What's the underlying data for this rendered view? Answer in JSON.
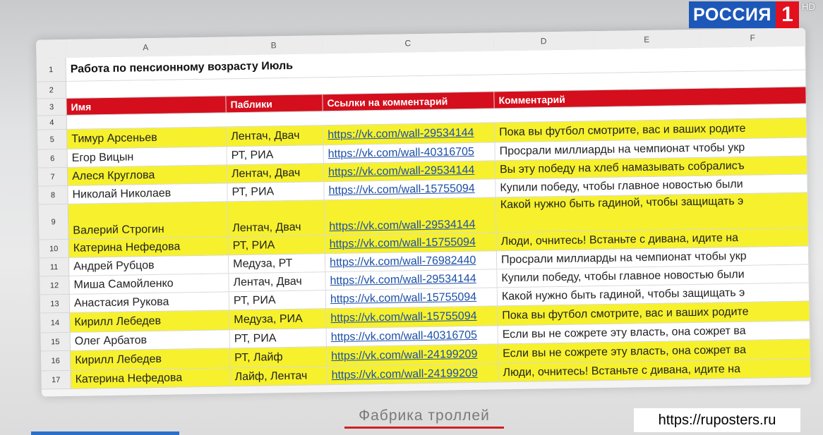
{
  "overlay": {
    "channel_logo": "РОССИЯ",
    "channel_number": "1",
    "hd_badge": "HD",
    "caption": "Фабрика троллей",
    "watermark": "https://ruposters.ru"
  },
  "spreadsheet": {
    "columns": [
      "A",
      "B",
      "C",
      "D",
      "E",
      "F"
    ],
    "title": "Работа по пенсионному возрасту Июль",
    "headers": [
      "Имя",
      "Паблики",
      "Ссылки на комментарий",
      "Комментарий"
    ],
    "row_numbers": [
      "1",
      "2",
      "3",
      "4",
      "5",
      "6",
      "7",
      "8",
      "9",
      "10",
      "11",
      "12",
      "13",
      "14",
      "15",
      "16",
      "17"
    ],
    "rows": [
      {
        "name": "Тимур Арсеньев",
        "publics": "Лентач, Двач",
        "link": "https://vk.com/wall-29534144",
        "comment": "Пока вы футбол смотрите, вас и ваших родите",
        "highlight": "yellow"
      },
      {
        "name": "Егор Вицын",
        "publics": "РТ, РИА",
        "link": "https://vk.com/wall-40316705",
        "comment": "Просрали миллиарды на чемпионат чтобы укр",
        "highlight": "white"
      },
      {
        "name": "Алеся Круглова",
        "publics": "Лентач, Двач",
        "link": "https://vk.com/wall-29534144",
        "comment": "Вы эту победу на хлеб намазывать собралисъ",
        "highlight": "yellow"
      },
      {
        "name": "Николай Николаев",
        "publics": "РТ, РИА",
        "link": "https://vk.com/wall-15755094",
        "comment": "Купили победу, чтобы  главное новостью были",
        "highlight": "white"
      },
      {
        "name": "Валерий Строгин",
        "publics": "Лентач, Двач",
        "link": "https://vk.com/wall-29534144",
        "comment": "Какой нужно быть гадиной, чтобы защищать э",
        "highlight": "yellow"
      },
      {
        "name": "Катерина Нефедова",
        "publics": "РТ, РИА",
        "link": "https://vk.com/wall-15755094",
        "comment": "Люди, очнитесь! Встаньте с дивана, идите на",
        "highlight": "yellow"
      },
      {
        "name": "Андрей Рубцов",
        "publics": "Медуза, РТ",
        "link": "https://vk.com/wall-76982440",
        "comment": "Просрали миллиарды на чемпионат чтобы укр",
        "highlight": "white"
      },
      {
        "name": "Миша Самойленко",
        "publics": "Лентач, Двач",
        "link": "https://vk.com/wall-29534144",
        "comment": "Купили победу, чтобы главное новостью были",
        "highlight": "white"
      },
      {
        "name": "Анастасия Рукова",
        "publics": "РТ, РИА",
        "link": "https://vk.com/wall-15755094",
        "comment": "Какой нужно быть гадиной, чтобы защищать э",
        "highlight": "white"
      },
      {
        "name": "Кирилл Лебедев",
        "publics": "Медуза, РИА",
        "link": "https://vk.com/wall-15755094",
        "comment": "Пока вы футбол смотрите, вас и ваших родите",
        "highlight": "yellow"
      },
      {
        "name": "Олег Арбатов",
        "publics": "РТ, РИА",
        "link": "https://vk.com/wall-40316705",
        "comment": "Если вы не сожрете эту власть, она сожрет ва",
        "highlight": "white"
      },
      {
        "name": "Кирилл Лебедев",
        "publics": "РТ, Лайф",
        "link": "https://vk.com/wall-24199209",
        "comment": "Если вы не сожрете эту власть, она сожрет ва",
        "highlight": "yellow"
      },
      {
        "name": "Катерина Нефедова",
        "publics": "Лайф, Лентач",
        "link": "https://vk.com/wall-24199209",
        "comment": "Люди, очнитесь! Встаньте с дивана, идите на",
        "highlight": "yellow"
      }
    ]
  },
  "colors": {
    "header_red": "#d40e1c",
    "highlight_yellow": "#f6f12c",
    "logo_blue": "#1d58b8",
    "logo_red": "#e3101e",
    "caption_underline": "#d32020"
  }
}
